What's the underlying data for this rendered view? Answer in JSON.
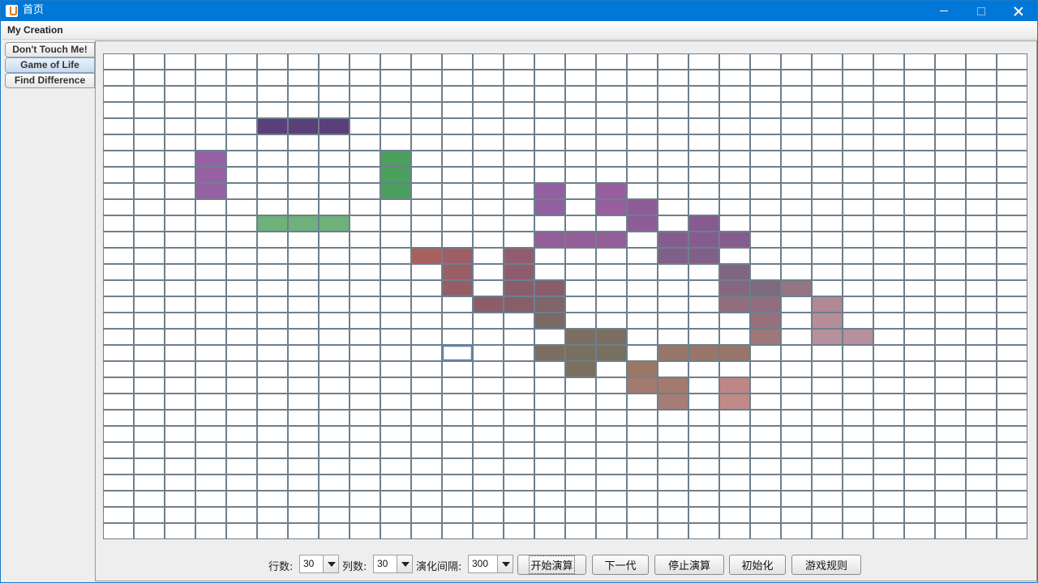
{
  "window": {
    "title": "首页",
    "icon": "java-cup-icon"
  },
  "menubar": {
    "items": [
      "My Creation"
    ]
  },
  "tabs": [
    {
      "label": "Don't Touch Me!",
      "selected": false
    },
    {
      "label": "Game of Life",
      "selected": true
    },
    {
      "label": "Find Difference",
      "selected": false
    }
  ],
  "board": {
    "rows": 30,
    "cols": 30,
    "selected_cell": [
      18,
      11
    ],
    "colors": {
      "grid_line": "#6e7f8c",
      "empty": "#ffffff",
      "selected_border": "#5b86b8"
    },
    "live_cells": [
      {
        "r": 4,
        "c": 5,
        "color": "#5b3f78"
      },
      {
        "r": 4,
        "c": 6,
        "color": "#5b3f78"
      },
      {
        "r": 4,
        "c": 7,
        "color": "#5b3f78"
      },
      {
        "r": 6,
        "c": 3,
        "color": "#9561a3"
      },
      {
        "r": 7,
        "c": 3,
        "color": "#9561a3"
      },
      {
        "r": 8,
        "c": 3,
        "color": "#9561a3"
      },
      {
        "r": 6,
        "c": 9,
        "color": "#4ba05e"
      },
      {
        "r": 7,
        "c": 9,
        "color": "#4ba05e"
      },
      {
        "r": 8,
        "c": 9,
        "color": "#4ba05e"
      },
      {
        "r": 10,
        "c": 5,
        "color": "#6fb07c"
      },
      {
        "r": 10,
        "c": 6,
        "color": "#6fb07c"
      },
      {
        "r": 10,
        "c": 7,
        "color": "#6fb07c"
      },
      {
        "r": 8,
        "c": 14,
        "color": "#9260a1"
      },
      {
        "r": 9,
        "c": 14,
        "color": "#9260a1"
      },
      {
        "r": 8,
        "c": 16,
        "color": "#985e9f"
      },
      {
        "r": 9,
        "c": 16,
        "color": "#985e9f"
      },
      {
        "r": 9,
        "c": 17,
        "color": "#8d5d97"
      },
      {
        "r": 10,
        "c": 17,
        "color": "#8d5d97"
      },
      {
        "r": 10,
        "c": 19,
        "color": "#855b91"
      },
      {
        "r": 11,
        "c": 14,
        "color": "#945f98"
      },
      {
        "r": 11,
        "c": 15,
        "color": "#945f98"
      },
      {
        "r": 11,
        "c": 16,
        "color": "#945f98"
      },
      {
        "r": 11,
        "c": 18,
        "color": "#855c8e"
      },
      {
        "r": 11,
        "c": 19,
        "color": "#855c8e"
      },
      {
        "r": 11,
        "c": 20,
        "color": "#855c8e"
      },
      {
        "r": 12,
        "c": 18,
        "color": "#806089"
      },
      {
        "r": 12,
        "c": 19,
        "color": "#806089"
      },
      {
        "r": 12,
        "c": 10,
        "color": "#a8605f"
      },
      {
        "r": 12,
        "c": 11,
        "color": "#9e5f66"
      },
      {
        "r": 12,
        "c": 13,
        "color": "#935d70"
      },
      {
        "r": 13,
        "c": 11,
        "color": "#9a5e66"
      },
      {
        "r": 13,
        "c": 13,
        "color": "#8e5c6e"
      },
      {
        "r": 13,
        "c": 20,
        "color": "#7f6680"
      },
      {
        "r": 14,
        "c": 11,
        "color": "#955e66"
      },
      {
        "r": 14,
        "c": 13,
        "color": "#8a5d6b"
      },
      {
        "r": 14,
        "c": 14,
        "color": "#8a5d6b"
      },
      {
        "r": 14,
        "c": 20,
        "color": "#86677f"
      },
      {
        "r": 14,
        "c": 21,
        "color": "#7d6a7c"
      },
      {
        "r": 14,
        "c": 22,
        "color": "#937583"
      },
      {
        "r": 15,
        "c": 12,
        "color": "#8c5d69"
      },
      {
        "r": 15,
        "c": 13,
        "color": "#865f69"
      },
      {
        "r": 15,
        "c": 14,
        "color": "#7f6568"
      },
      {
        "r": 15,
        "c": 20,
        "color": "#916d7e"
      },
      {
        "r": 15,
        "c": 21,
        "color": "#916d7e"
      },
      {
        "r": 15,
        "c": 23,
        "color": "#b08995"
      },
      {
        "r": 16,
        "c": 14,
        "color": "#7a6a63"
      },
      {
        "r": 16,
        "c": 21,
        "color": "#98707b"
      },
      {
        "r": 16,
        "c": 23,
        "color": "#b58e9a"
      },
      {
        "r": 17,
        "c": 15,
        "color": "#7b6e60"
      },
      {
        "r": 17,
        "c": 16,
        "color": "#7b6e60"
      },
      {
        "r": 17,
        "c": 21,
        "color": "#9f7779"
      },
      {
        "r": 17,
        "c": 23,
        "color": "#b6909c"
      },
      {
        "r": 17,
        "c": 24,
        "color": "#b6909c"
      },
      {
        "r": 18,
        "c": 14,
        "color": "#7b6e60"
      },
      {
        "r": 18,
        "c": 15,
        "color": "#77705f"
      },
      {
        "r": 18,
        "c": 16,
        "color": "#77705f"
      },
      {
        "r": 18,
        "c": 18,
        "color": "#98766a"
      },
      {
        "r": 18,
        "c": 19,
        "color": "#98766a"
      },
      {
        "r": 18,
        "c": 20,
        "color": "#98766a"
      },
      {
        "r": 19,
        "c": 15,
        "color": "#7a705f"
      },
      {
        "r": 19,
        "c": 17,
        "color": "#9a7866"
      },
      {
        "r": 20,
        "c": 17,
        "color": "#a27a6e"
      },
      {
        "r": 20,
        "c": 18,
        "color": "#a27a6e"
      },
      {
        "r": 20,
        "c": 20,
        "color": "#bc8786"
      },
      {
        "r": 21,
        "c": 18,
        "color": "#a57d74"
      },
      {
        "r": 21,
        "c": 20,
        "color": "#c08a86"
      }
    ]
  },
  "controls": {
    "rows_label": "行数:",
    "rows_value": "30",
    "cols_label": "列数:",
    "cols_value": "30",
    "interval_label": "演化间隔:",
    "interval_value": "300",
    "start_label": "开始演算",
    "next_label": "下一代",
    "stop_label": "停止演算",
    "init_label": "初始化",
    "rules_label": "游戏规则"
  }
}
